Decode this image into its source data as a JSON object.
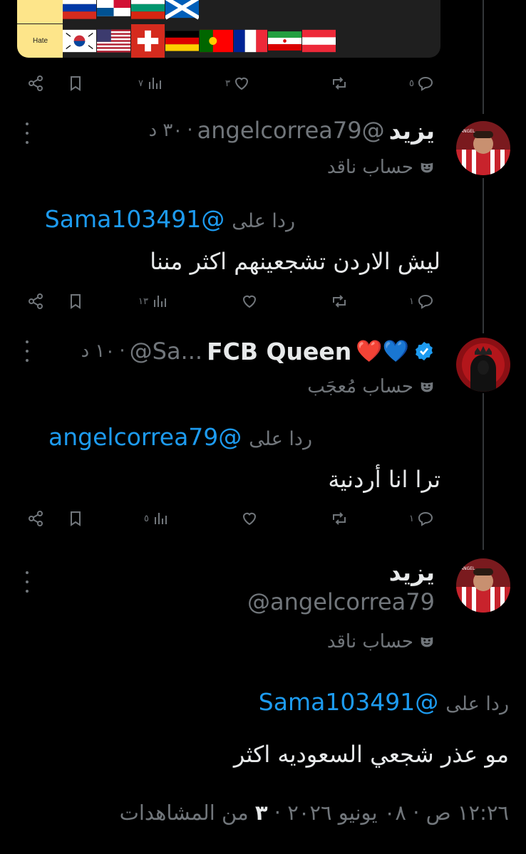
{
  "media_card": {
    "tier_label": "Hate"
  },
  "action_bar_1": {
    "replies": "٥",
    "reposts": "",
    "likes": "٣",
    "views": "٧"
  },
  "tweet_1": {
    "name": "يزيد",
    "handle": "@angelcorrea79",
    "time": "٣٠ د",
    "badge": "حساب ناقد",
    "reply_prefix": "ردا على",
    "reply_to": "@Sama103491",
    "text": "ليش الاردن تشجعينهم اكثر مننا"
  },
  "action_bar_2": {
    "replies": "١",
    "reposts": "",
    "likes": "",
    "views": "١٣"
  },
  "tweet_2": {
    "name": "FCB Queen",
    "emoji": "💙❤️",
    "handle": "@Sa...",
    "time": "١٠ د",
    "badge": "حساب مُعجَب",
    "reply_prefix": "ردا على",
    "reply_to": "@angelcorrea79",
    "text": "ترا انا أردنية"
  },
  "action_bar_3": {
    "replies": "١",
    "reposts": "",
    "likes": "",
    "views": "٥"
  },
  "tweet_3": {
    "name": "يزيد",
    "handle": "@angelcorrea79",
    "badge": "حساب ناقد",
    "reply_prefix": "ردا على",
    "reply_to": "@Sama103491",
    "text": "مو عذر شجعي السعوديه اكثر",
    "timestamp": "١٢:٢٦ ص · ٠٨ يونيو ٢٠٢٦",
    "views_count": "٣",
    "views_label": "من المشاهدات"
  },
  "colors": {
    "accent": "#1d9bf0",
    "muted": "#71767b",
    "background": "#000000"
  },
  "icons": [
    "share-icon",
    "bookmark-icon",
    "views-icon",
    "like-icon",
    "repost-icon",
    "reply-icon",
    "more-icon",
    "mask-icon",
    "verified-icon"
  ]
}
